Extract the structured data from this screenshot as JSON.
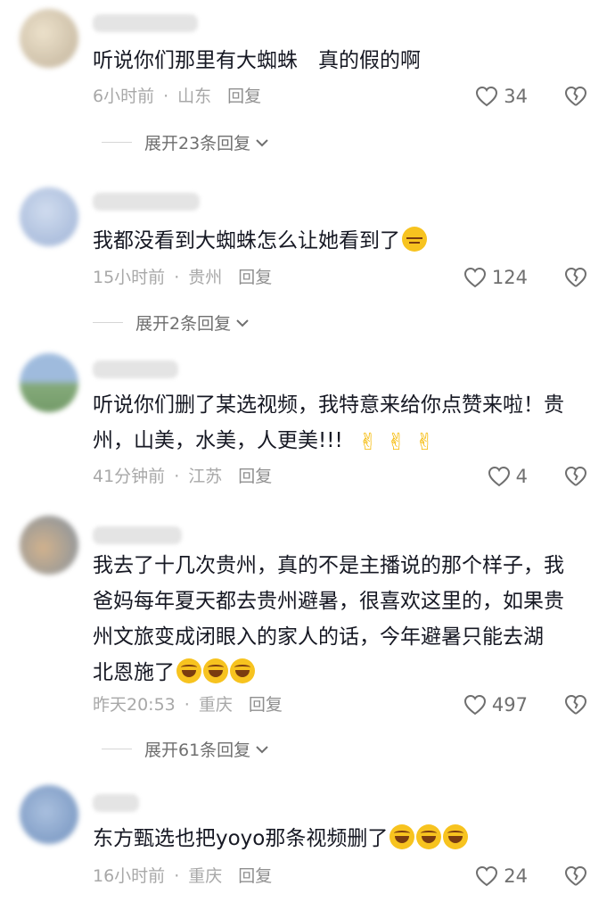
{
  "comments": [
    {
      "text": "听说你们那里有大蜘蛛　真的假的啊",
      "time": "6小时前",
      "location": "山东",
      "reply_label": "回复",
      "likes": "34",
      "expand": "展开23条回复"
    },
    {
      "text": "我都没看到大蜘蛛怎么让她看到了",
      "time": "15小时前",
      "location": "贵州",
      "reply_label": "回复",
      "likes": "124",
      "expand": "展开2条回复"
    },
    {
      "text_line1": "听说你们删了某选视频，我特意来给你点赞来啦！贵",
      "text_line2": "州，山美，水美，人更美!!!",
      "time": "41分钟前",
      "location": "江苏",
      "reply_label": "回复",
      "likes": "4"
    },
    {
      "text_line1": "我去了十几次贵州，真的不是主播说的那个样子，我",
      "text_line2": "爸妈每年夏天都去贵州避暑，很喜欢这里的，如果贵",
      "text_line3": "州文旅变成闭眼入的家人的话，今年避暑只能去湖",
      "text_line4": "北恩施了",
      "time": "昨天20:53",
      "location": "重庆",
      "reply_label": "回复",
      "likes": "497",
      "expand": "展开61条回复"
    },
    {
      "text": "东方甄选也把yoyo那条视频删了",
      "time": "16小时前",
      "location": "重庆",
      "reply_label": "回复",
      "likes": "24"
    }
  ],
  "icons": {
    "like": "heart-outline-icon",
    "dislike": "broken-heart-icon",
    "expand": "chevron-down-icon",
    "emoji_laugh": "laughing-tears-emoji",
    "emoji_meh": "unamused-emoji",
    "emoji_heart_hands": "finger-heart-emoji"
  },
  "colors": {
    "text": "#161823",
    "meta": "#a8a8a8",
    "icon": "#6f6f6f"
  }
}
